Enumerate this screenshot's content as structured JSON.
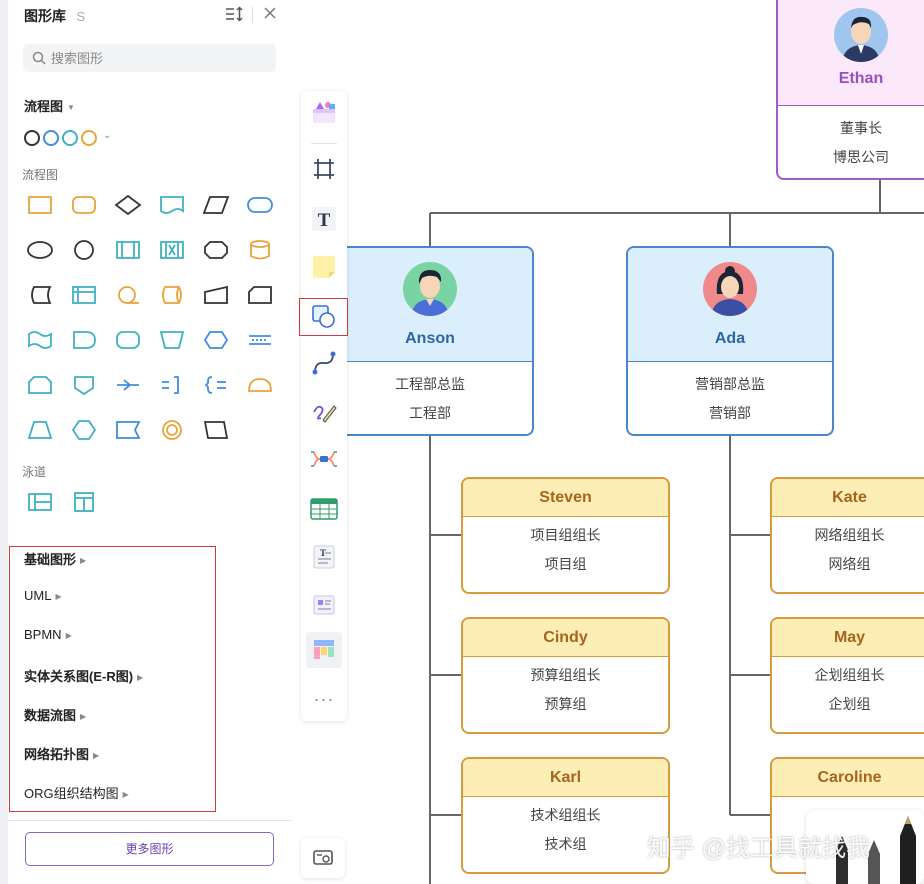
{
  "panel": {
    "title": "图形库",
    "shortcut": "S",
    "search_placeholder": "搜索图形",
    "section_flowchart_title": "流程图",
    "category_flowchart_label": "流程图",
    "category_lane_label": "泳道",
    "library_items": [
      {
        "label": "基础图形",
        "bold": true
      },
      {
        "label": "UML",
        "bold": false
      },
      {
        "label": "BPMN",
        "bold": false
      },
      {
        "label": "实体关系图(E-R图)",
        "bold": true
      },
      {
        "label": "数据流图",
        "bold": true
      },
      {
        "label": "网络拓扑图",
        "bold": true
      },
      {
        "label": "ORG组织结构图",
        "bold": false
      }
    ],
    "more_button": "更多图形"
  },
  "colors": {
    "shape_stroke_orange": "#e8a43a",
    "shape_stroke_teal": "#3fb0c4",
    "shape_stroke_dark": "#333333",
    "highlight_red": "#d23b3b",
    "accent_purple": "#6a40b6"
  },
  "toolbar": {
    "tools": [
      "template-icon",
      "frame-icon",
      "text-icon",
      "sticky-note-icon",
      "shape-icon",
      "connector-icon",
      "pen-icon",
      "mindmap-icon",
      "table-icon",
      "document-icon",
      "card-icon",
      "kanban-icon",
      "more-icon"
    ],
    "selected_tool": "shape-icon",
    "bottom_tool": "map-settings-icon"
  },
  "org_chart": {
    "root": {
      "name": "Ethan",
      "title": "董事长",
      "dept": "博思公司"
    },
    "managers": [
      {
        "name": "Anson",
        "title": "工程部总监",
        "dept": "工程部"
      },
      {
        "name": "Ada",
        "title": "营销部总监",
        "dept": "营销部"
      }
    ],
    "leaders": [
      {
        "name": "Steven",
        "title": "项目组组长",
        "dept": "项目组"
      },
      {
        "name": "Cindy",
        "title": "预算组组长",
        "dept": "预算组"
      },
      {
        "name": "Karl",
        "title": "技术组组长",
        "dept": "技术组"
      },
      {
        "name": "Kate",
        "title": "网络组组长",
        "dept": "网络组"
      },
      {
        "name": "May",
        "title": "企划组组长",
        "dept": "企划组"
      },
      {
        "name": "Caroline",
        "title": "",
        "dept": ""
      }
    ]
  },
  "watermark": "知乎 @找工具就找我"
}
